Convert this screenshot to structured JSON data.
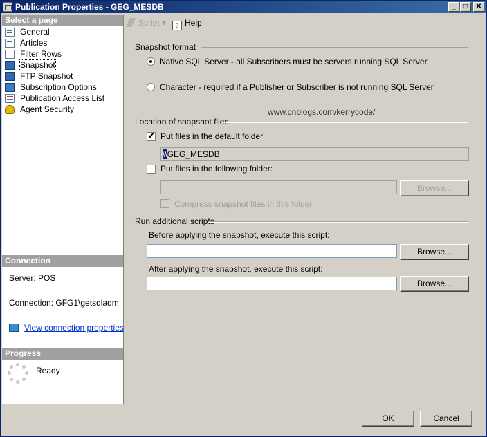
{
  "window": {
    "title": "Publication Properties - GEG_MESDB"
  },
  "title_buttons": {
    "minimize": "_",
    "maximize": "□",
    "close": "✕"
  },
  "sidebar": {
    "select_page_header": "Select a page",
    "items": [
      {
        "label": "General",
        "icon": "general-page-icon"
      },
      {
        "label": "Articles",
        "icon": "articles-page-icon"
      },
      {
        "label": "Filter Rows",
        "icon": "filter-rows-page-icon"
      },
      {
        "label": "Snapshot",
        "icon": "snapshot-page-icon"
      },
      {
        "label": "FTP Snapshot",
        "icon": "ftp-snapshot-page-icon"
      },
      {
        "label": "Subscription Options",
        "icon": "subscription-options-page-icon"
      },
      {
        "label": "Publication Access List",
        "icon": "access-list-page-icon"
      },
      {
        "label": "Agent Security",
        "icon": "agent-security-page-icon"
      }
    ],
    "selected_index": 3,
    "connection_header": "Connection",
    "server": "Server: POS",
    "connection": "Connection: GFG1\\getsqladm",
    "view_link": "View connection properties",
    "progress_header": "Progress",
    "progress_status": "Ready"
  },
  "toolbar": {
    "script_label": "Script",
    "help_label": "Help"
  },
  "snapshot_format": {
    "label": "Snapshot format",
    "native_label": "Native SQL Server - all Subscribers must be servers running SQL Server",
    "character_label": "Character - required if a Publisher or Subscriber is not running SQL Server",
    "selected": "native"
  },
  "watermark": "www.cnblogs.com/kerrycode/",
  "location": {
    "label": "Location of snapshot files",
    "default_folder_label": "Put files in the default folder",
    "default_folder_checked": true,
    "default_path_highlight": "\\\\",
    "default_path_rest": "GEG_MESDB",
    "following_folder_label": "Put files in the following folder:",
    "following_folder_checked": false,
    "following_path": "",
    "browse_label": "Browse...",
    "compress_label": "Compress snapshot files in this folder"
  },
  "scripts": {
    "label": "Run additional scripts",
    "before_label": "Before applying the snapshot, execute this script:",
    "before_value": "",
    "after_label": "After applying the snapshot, execute this script:",
    "after_value": "",
    "browse_label": "Browse..."
  },
  "buttons": {
    "ok": "OK",
    "cancel": "Cancel"
  },
  "colors": {
    "title_bar": "#0a246a",
    "link": "#0033cc",
    "sidebar_header": "#a0a0a0",
    "face": "#d4d0c8"
  }
}
